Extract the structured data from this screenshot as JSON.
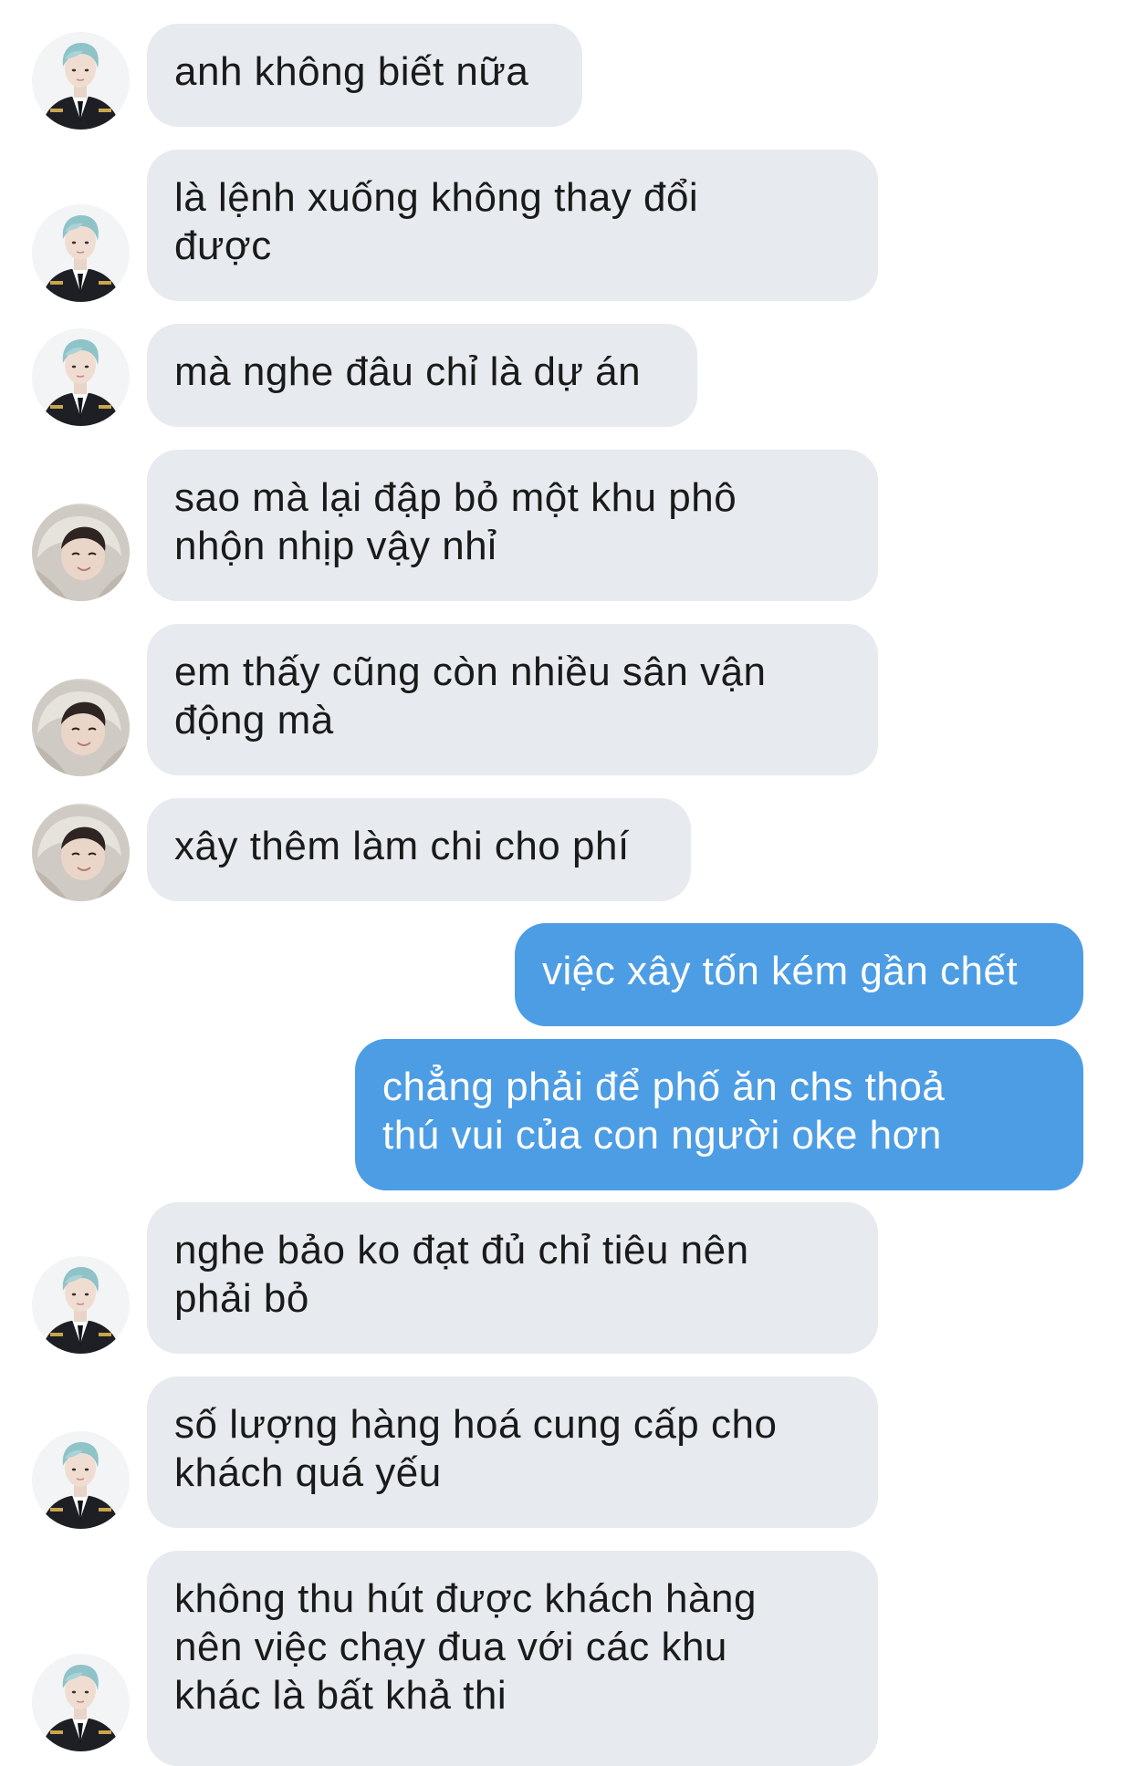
{
  "conversation": {
    "messages": [
      {
        "side": "in",
        "sender": "officer",
        "text": "anh không biết nữa"
      },
      {
        "side": "in",
        "sender": "officer",
        "text": "là lệnh xuống không thay đổi\nđược"
      },
      {
        "side": "in",
        "sender": "officer",
        "text": "mà nghe đâu chỉ là dự án"
      },
      {
        "side": "in",
        "sender": "hoodie",
        "text": "sao mà lại đập bỏ một khu phô\nnhộn nhịp vậy nhỉ"
      },
      {
        "side": "in",
        "sender": "hoodie",
        "text": "em thấy cũng còn nhiều sân vận\nđộng mà"
      },
      {
        "side": "in",
        "sender": "hoodie",
        "text": "xây thêm làm chi cho phí"
      },
      {
        "side": "out",
        "sender": "me",
        "text": "việc xây tốn kém gần chết"
      },
      {
        "side": "out",
        "sender": "me",
        "text": "chẳng phải để phố ăn chs thoả\nthú vui của con người oke hơn"
      },
      {
        "side": "in",
        "sender": "officer",
        "text": "nghe bảo ko đạt đủ chỉ tiêu nên\nphải bỏ"
      },
      {
        "side": "in",
        "sender": "officer",
        "text": "số lượng hàng hoá cung cấp cho\nkhách quá yếu"
      },
      {
        "side": "in",
        "sender": "officer",
        "text": "không thu hút được khách hàng\nnên việc chạy đua với các khu\nkhác là bất khả thi"
      }
    ]
  },
  "colors": {
    "incoming_bubble": "#e7eaee",
    "outgoing_bubble": "#4d9de5",
    "incoming_text": "#1a1a1a",
    "outgoing_text": "#ffffff"
  },
  "icons": {
    "officer": "avatar-officer-icon",
    "hoodie": "avatar-hoodie-icon"
  }
}
